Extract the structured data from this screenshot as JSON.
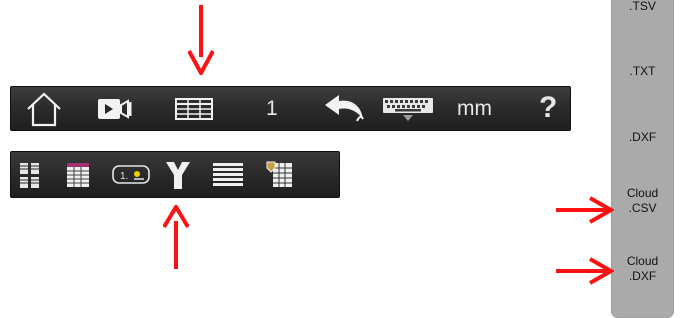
{
  "main_toolbar": {
    "items": [
      {
        "icon": "home-icon"
      },
      {
        "icon": "video-camera-icon"
      },
      {
        "icon": "table-view-icon"
      },
      {
        "text": "1"
      },
      {
        "icon": "undo-icon"
      },
      {
        "icon": "keyboard-icon"
      },
      {
        "text": "mm"
      },
      {
        "text": "?"
      }
    ],
    "count_label": "1",
    "units_label": "mm",
    "help_label": "?"
  },
  "sub_toolbar": {
    "items": [
      {
        "icon": "copy-table-icon"
      },
      {
        "icon": "grid-table-icon"
      },
      {
        "icon": "numbered-field-icon"
      },
      {
        "icon": "split-y-icon"
      },
      {
        "icon": "lines-list-icon"
      },
      {
        "icon": "table-edit-icon"
      }
    ],
    "field_number": "1."
  },
  "export_panel": {
    "items": [
      {
        "label": ".TSV"
      },
      {
        "label": ".TXT"
      },
      {
        "label": ".DXF"
      },
      {
        "line1": "Cloud",
        "line2": ".CSV"
      },
      {
        "line1": "Cloud",
        "line2": ".DXF"
      }
    ]
  },
  "colors": {
    "arrow": "#ff1111",
    "toolbar_bg": "#2b2b2b",
    "panel_bg": "#aaaaaa"
  }
}
